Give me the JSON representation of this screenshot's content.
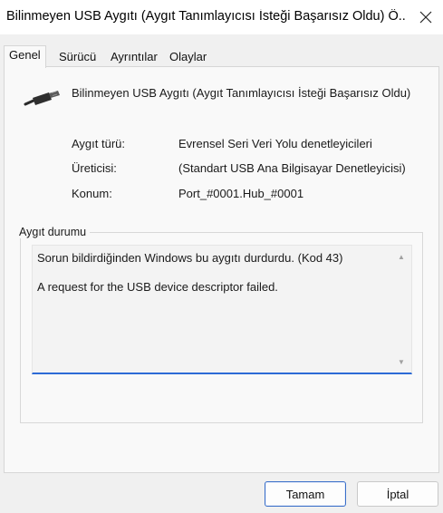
{
  "window": {
    "title": "Bilinmeyen USB Aygıtı (Aygıt Tanımlayıcısı İsteği Başarısız Oldu) Ö..."
  },
  "tabs": [
    {
      "label": "Genel"
    },
    {
      "label": "Sürücü"
    },
    {
      "label": "Ayrıntılar"
    },
    {
      "label": "Olaylar"
    }
  ],
  "device": {
    "name": "Bilinmeyen USB Aygıtı (Aygıt Tanımlayıcısı İsteği Başarısız Oldu)",
    "icon": "usb-plug-icon"
  },
  "properties": [
    {
      "label": "Aygıt türü:",
      "value": "Evrensel Seri Veri Yolu denetleyicileri"
    },
    {
      "label": "Üreticisi:",
      "value": "(Standart USB Ana Bilgisayar Denetleyicisi)"
    },
    {
      "label": "Konum:",
      "value": "Port_#0001.Hub_#0001"
    }
  ],
  "status": {
    "legend": "Aygıt durumu",
    "line1": "Sorun bildirdiğinden Windows bu aygıtı durdurdu. (Kod 43)",
    "line2": "A request for the USB device descriptor failed."
  },
  "buttons": {
    "ok": "Tamam",
    "cancel": "İptal"
  },
  "colors": {
    "focus_underline": "#2d6bd6",
    "default_button_border": "#3a6fc9"
  }
}
